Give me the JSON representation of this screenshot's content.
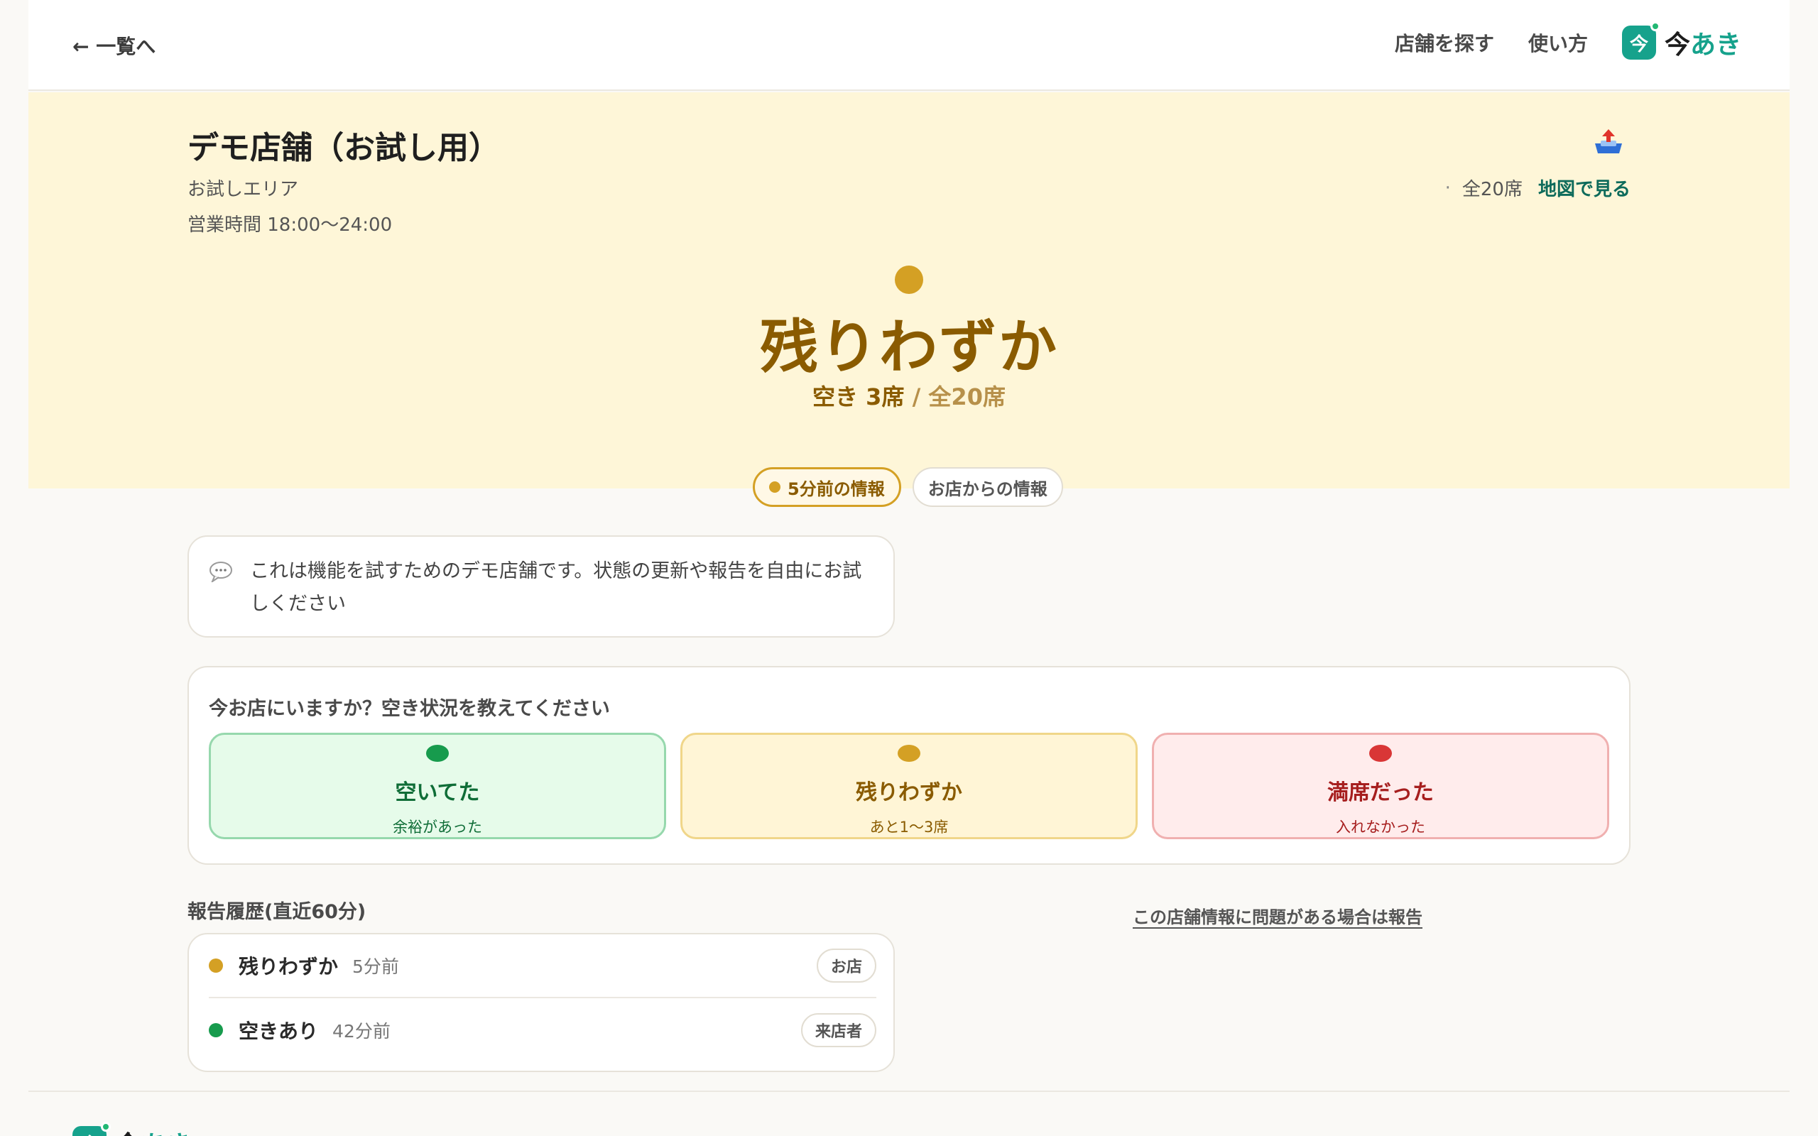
{
  "header": {
    "back_label": "← 一覧へ",
    "nav": {
      "find": "店舗を探す",
      "how": "使い方"
    },
    "logo": {
      "mark": "今",
      "text_a": "今",
      "text_b": "あき",
      "color": "#16a28c"
    }
  },
  "store": {
    "name": "デモ店舗（お試し用）",
    "area": "お試しエリア",
    "hours": "営業時間 18:00〜24:00",
    "seats_total_label": "全20席",
    "map_link": "地図で見る",
    "separator": "·"
  },
  "status": {
    "label": "残りわずか",
    "vacant": "空き 3席",
    "total": "/ 全20席",
    "color": "#d4a024",
    "freshness": "5分前の情報",
    "source": "お店からの情報"
  },
  "note": {
    "text": "これは機能を試すためのデモ店舗です。状態の更新や報告を自由にお試しください",
    "icon": "speech-bubble-icon"
  },
  "report": {
    "question": "今お店にいますか？空き状況を教えてください",
    "choices": [
      {
        "label": "空いてた",
        "sub": "余裕があった",
        "color": "#179b4d"
      },
      {
        "label": "残りわずか",
        "sub": "あと1〜3席",
        "color": "#d4a024"
      },
      {
        "label": "満席だった",
        "sub": "入れなかった",
        "color": "#d93636"
      }
    ]
  },
  "history": {
    "title": "報告履歴(直近60分)",
    "problem_link": "この店舗情報に問題がある場合は報告",
    "rows": [
      {
        "status": "残りわずか",
        "time": "5分前",
        "badge": "お店",
        "color": "#d4a024"
      },
      {
        "status": "空きあり",
        "time": "42分前",
        "badge": "来店者",
        "color": "#179b4d"
      }
    ]
  },
  "footer": {
    "logo_a": "今",
    "logo_b": "あき"
  }
}
